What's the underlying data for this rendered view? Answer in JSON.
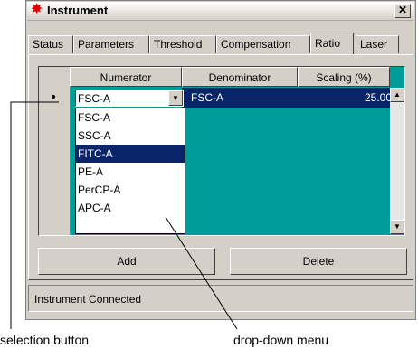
{
  "window": {
    "title": "Instrument",
    "close_label": "✕"
  },
  "tabs": [
    {
      "label": "Status"
    },
    {
      "label": "Parameters"
    },
    {
      "label": "Threshold"
    },
    {
      "label": "Compensation"
    },
    {
      "label": "Ratio",
      "active": true
    },
    {
      "label": "Laser"
    }
  ],
  "grid": {
    "headers": [
      "Numerator",
      "Denominator",
      "Scaling (%)"
    ],
    "row": {
      "numerator": "FSC-A",
      "denominator": "FSC-A",
      "scaling": "25.00"
    }
  },
  "dropdown": {
    "options": [
      "FSC-A",
      "SSC-A",
      "FITC-A",
      "PE-A",
      "PerCP-A",
      "APC-A"
    ],
    "highlighted": "FITC-A"
  },
  "buttons": {
    "add": "Add",
    "delete": "Delete"
  },
  "status": "Instrument Connected",
  "callouts": {
    "selection": "selection button",
    "dropdown": "drop-down menu"
  },
  "colors": {
    "grid_bg": "#009c9c",
    "selection": "#0a246a",
    "face": "#d4d0c8"
  }
}
